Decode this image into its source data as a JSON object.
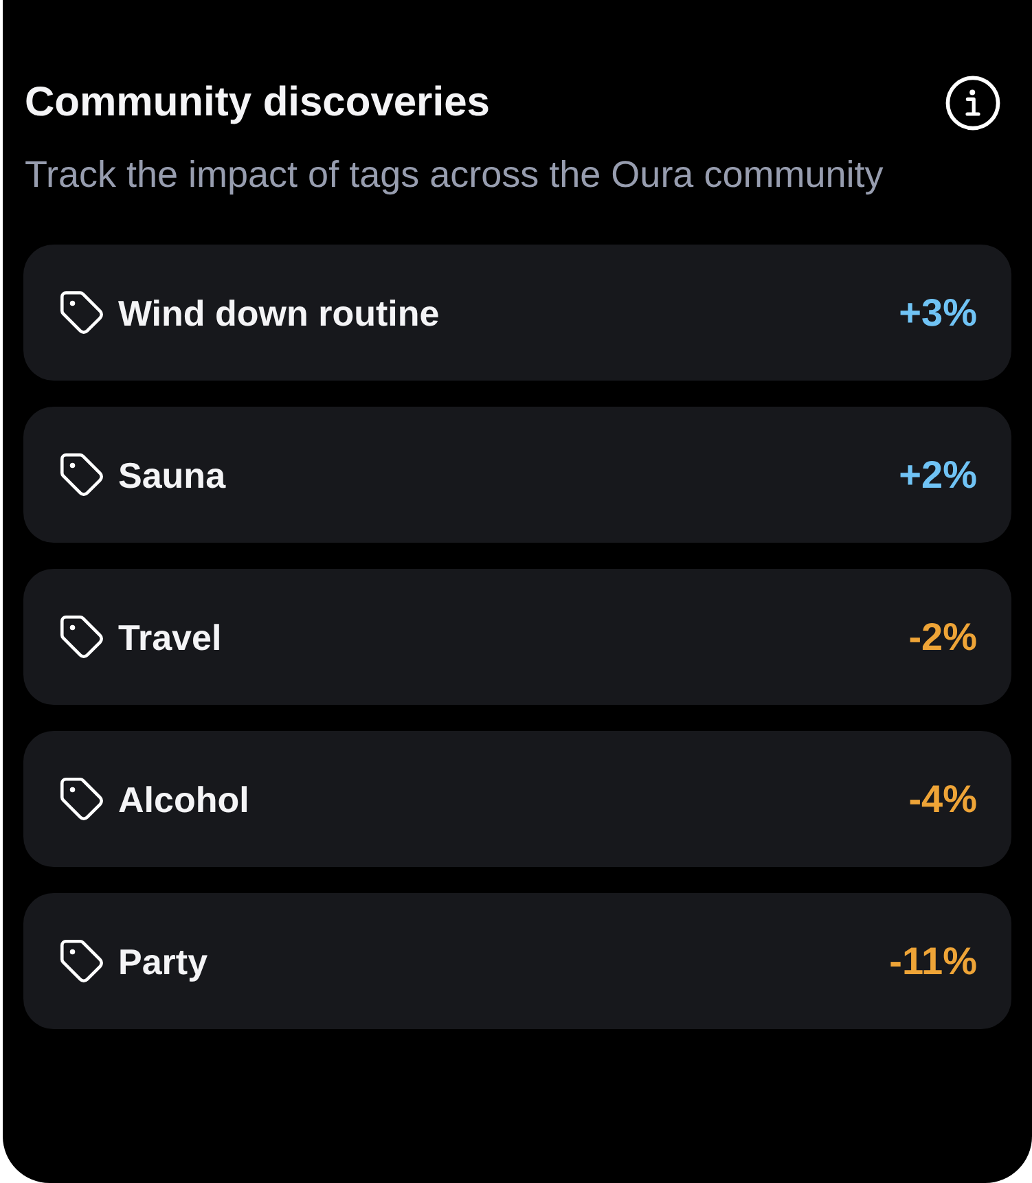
{
  "header": {
    "title": "Community discoveries",
    "subtitle": "Track the impact of tags across the Oura community"
  },
  "tags": [
    {
      "label": "Wind down routine",
      "change": "+3%",
      "color": "#70c3f5"
    },
    {
      "label": "Sauna",
      "change": "+2%",
      "color": "#70c3f5"
    },
    {
      "label": "Travel",
      "change": "-2%",
      "color": "#eea437"
    },
    {
      "label": "Alcohol",
      "change": "-4%",
      "color": "#eea437"
    },
    {
      "label": "Party",
      "change": "-11%",
      "color": "#eea437"
    }
  ]
}
